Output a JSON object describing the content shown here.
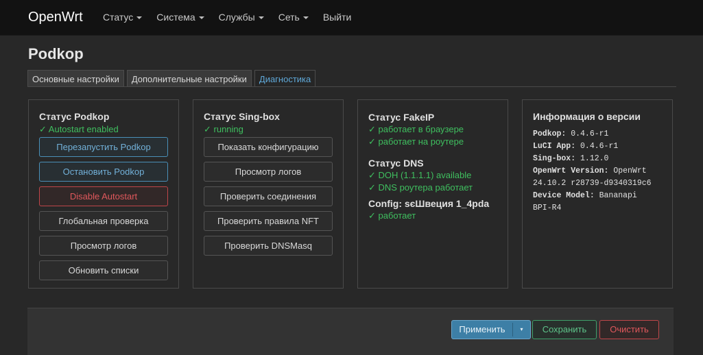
{
  "header": {
    "brand": "OpenWrt",
    "nav": [
      {
        "label": "Статус",
        "dropdown": true
      },
      {
        "label": "Система",
        "dropdown": true
      },
      {
        "label": "Службы",
        "dropdown": true
      },
      {
        "label": "Сеть",
        "dropdown": true
      },
      {
        "label": "Выйти",
        "dropdown": false
      }
    ]
  },
  "page": {
    "title": "Podkop",
    "tabs": [
      "Основные настройки",
      "Дополнительные настройки",
      "Диагностика"
    ],
    "active_tab": "Диагностика"
  },
  "podkop": {
    "title": "Статус Podkop",
    "status": "✓ Autostart enabled",
    "buttons": [
      "Перезапустить Podkop",
      "Остановить Podkop",
      "Disable Autostart",
      "Глобальная проверка",
      "Просмотр логов",
      "Обновить списки"
    ]
  },
  "singbox": {
    "title": "Статус Sing-box",
    "status": "✓ running",
    "buttons": [
      "Показать конфигурацию",
      "Просмотр логов",
      "Проверить соединения",
      "Проверить правила NFT",
      "Проверить DNSMasq"
    ]
  },
  "fakeip": {
    "title": "Статус FakeIP",
    "lines": [
      "✓ работает в браузере",
      "✓ работает на роутере"
    ],
    "dns_title": "Статус DNS",
    "dns_lines": [
      "✓ DOH (1.1.1.1) available",
      "✓ DNS роутера работает"
    ],
    "config_title": "Config: ѕєШвеция 1_4pda",
    "config_line": "✓ работает"
  },
  "version": {
    "title": "Информация о версии",
    "podkop_label": "Podkop:",
    "podkop_value": "0.4.6-r1",
    "luci_label": "LuCI App:",
    "luci_value": "0.4.6-r1",
    "singbox_label": "Sing-box:",
    "singbox_value": "1.12.0",
    "openwrt_label": "OpenWrt Version:",
    "openwrt_value": "OpenWrt",
    "openwrt_value2": "24.10.2 r28739-d9340319c6",
    "device_label": "Device Model:",
    "device_value": "Bananapi",
    "device_value2": "BPI-R4"
  },
  "footer": {
    "apply": "Применить",
    "save": "Сохранить",
    "reset": "Очистить"
  },
  "colors": {
    "ok_green": "#3fbf5f",
    "accent_blue": "#5fa8d8",
    "danger_red": "#e0585c"
  }
}
